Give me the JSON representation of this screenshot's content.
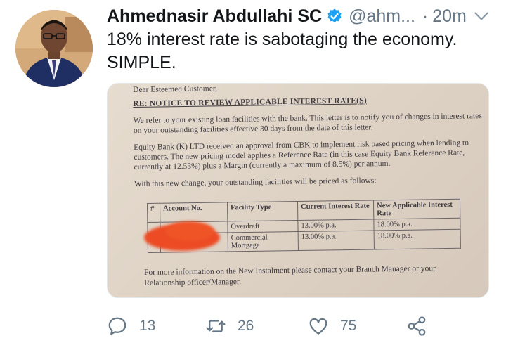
{
  "tweet": {
    "author_name": "Ahmednasir Abdullahi SC",
    "handle": "@ahm...",
    "separator": "·",
    "time": "20m",
    "text_lines": [
      "18% interest rate is sabotaging the economy.",
      "SIMPLE."
    ]
  },
  "letter": {
    "greeting": "Dear Esteemed Customer,",
    "subject": "RE: NOTICE TO REVIEW APPLICABLE INTEREST RATE(S)",
    "para1": "We refer to your existing loan facilities with the bank. This letter is to notify you of changes in interest rates on your outstanding facilities effective 30 days from the date of this letter.",
    "para2": "Equity Bank (K) LTD received an approval from CBK to implement risk based pricing when lending to customers. The new pricing model applies a Reference Rate (in this case Equity Bank Reference Rate, currently at 12.53%) plus a Margin (currently a maximum of 8.5%) per annum.",
    "para3": "With this new change, your outstanding facilities will be priced as follows:",
    "table_headers": [
      "#",
      "Account No.",
      "Facility Type",
      "Current Interest Rate",
      "New Applicable Interest Rate"
    ],
    "rows": [
      {
        "num": "",
        "account": "",
        "facility": "Overdraft",
        "current": "13.00% p.a.",
        "new": "18.00% p.a."
      },
      {
        "num": "",
        "account": "",
        "facility": "Commercial Mortgage",
        "current": "13.00% p.a.",
        "new": "18.00% p.a."
      }
    ],
    "footer": "For more information on the New Instalment please contact your Branch Manager or your Relationship officer/Manager."
  },
  "actions": {
    "reply_count": "13",
    "retweet_count": "26",
    "like_count": "75"
  },
  "colors": {
    "accent": "#1da1f2",
    "muted": "#657786",
    "text": "#14171a",
    "redaction": "#ec4b24"
  },
  "icons": [
    "verified-badge-icon",
    "chevron-down-icon",
    "reply-icon",
    "retweet-icon",
    "like-icon",
    "share-icon"
  ]
}
